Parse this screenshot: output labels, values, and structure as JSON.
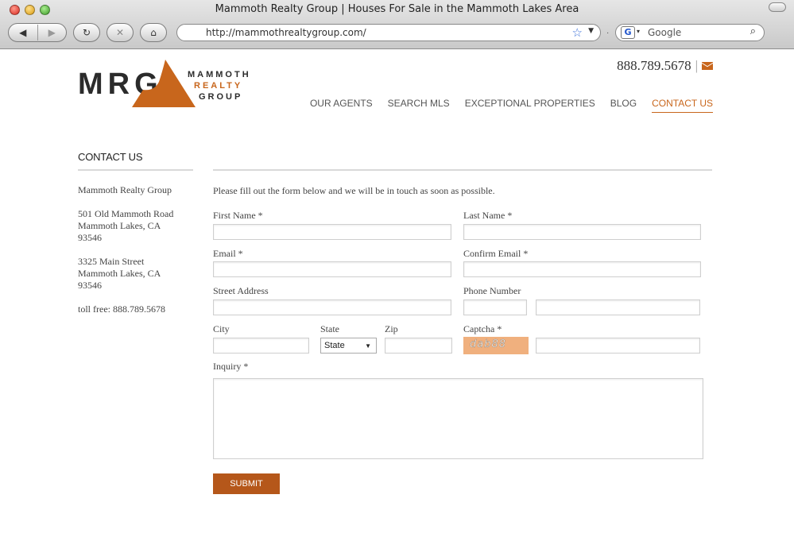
{
  "browser": {
    "window_title": "Mammoth Realty Group | Houses For Sale in the Mammoth Lakes Area",
    "url": "http://mammothrealtygroup.com/",
    "search_placeholder": "Google",
    "back_glyph": "◀",
    "forward_glyph": "▶",
    "reload_glyph": "↻",
    "stop_glyph": "✕",
    "home_glyph": "⌂"
  },
  "brand": {
    "logo_letters": "MRG",
    "logo_lines": [
      "MAMMOTH",
      "REALTY",
      "GROUP"
    ],
    "accent_color": "#c8661c"
  },
  "header": {
    "phone": "888.789.5678",
    "separator": "|",
    "nav": [
      {
        "label": "OUR AGENTS",
        "active": false
      },
      {
        "label": "SEARCH MLS",
        "active": false
      },
      {
        "label": "EXCEPTIONAL PROPERTIES",
        "active": false
      },
      {
        "label": "BLOG",
        "active": false
      },
      {
        "label": "CONTACT US",
        "active": true
      }
    ]
  },
  "sidebar": {
    "title": "CONTACT US",
    "company": "Mammoth Realty Group",
    "address1": [
      "501 Old Mammoth Road",
      "Mammoth Lakes, CA",
      "93546"
    ],
    "address2": [
      "3325 Main Street",
      "Mammoth Lakes, CA",
      "93546"
    ],
    "tollfree": "toll free: 888.789.5678"
  },
  "form": {
    "intro": "Please fill out the form below and we will be in touch as soon as possible.",
    "first_name_label": "First Name *",
    "last_name_label": "Last Name *",
    "email_label": "Email *",
    "confirm_email_label": "Confirm Email *",
    "street_label": "Street Address",
    "phone_label": "Phone Number",
    "city_label": "City",
    "state_label": "State",
    "state_value": "State",
    "zip_label": "Zip",
    "captcha_label": "Captcha *",
    "captcha_text": "dab88",
    "inquiry_label": "Inquiry *",
    "submit_label": "SUBMIT"
  }
}
